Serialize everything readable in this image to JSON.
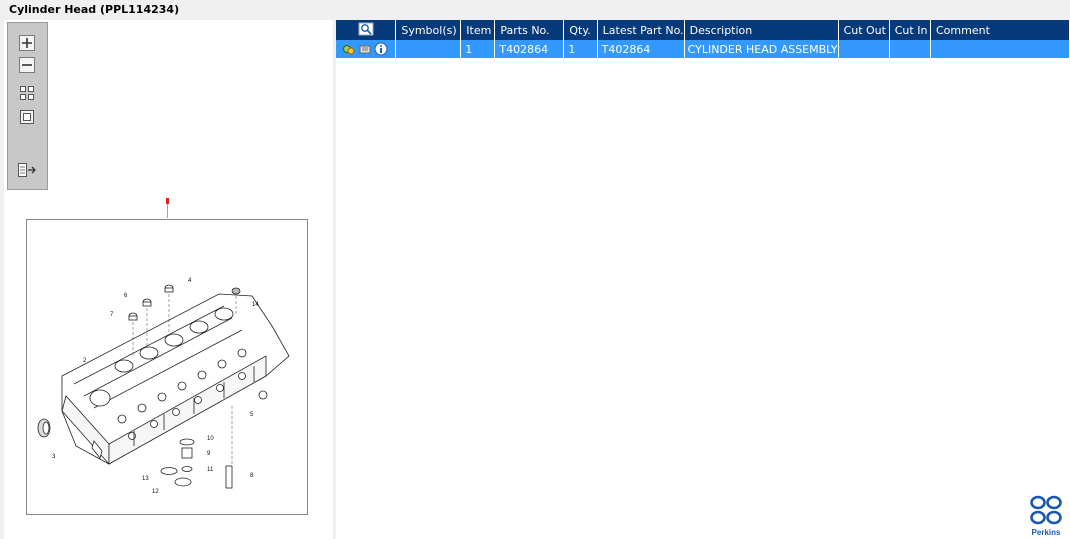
{
  "window": {
    "title": "Cylinder Head (PPL114234)"
  },
  "toolbar": {
    "zoom_in": "zoom-in-icon",
    "zoom_out": "zoom-out-icon",
    "fit_all": "fit-all-icon",
    "actual_size": "actual-size-icon",
    "toggle_panel": "toggle-panel-icon"
  },
  "drawing": {
    "marker_label": "1",
    "callouts": [
      "1",
      "2",
      "3",
      "4",
      "5",
      "6",
      "7",
      "8",
      "9",
      "10",
      "11",
      "12",
      "13",
      "14"
    ]
  },
  "table": {
    "headers": [
      "Symbol(s)",
      "Item",
      "Parts No.",
      "Qty.",
      "Latest Part No.",
      "Description",
      "Cut Out",
      "Cut In",
      "Comment"
    ],
    "rows": [
      {
        "symbols": "",
        "item": "1",
        "parts_no": "T402864",
        "qty": "1",
        "latest_part_no": "T402864",
        "description": "CYLINDER HEAD ASSEMBLY",
        "cut_out": "",
        "cut_in": "",
        "comment": ""
      }
    ]
  },
  "brand": {
    "name": "Perkins",
    "color": "#1a58b0"
  },
  "colors": {
    "header_bg": "#063a7a",
    "selected_row": "#3399ff"
  }
}
